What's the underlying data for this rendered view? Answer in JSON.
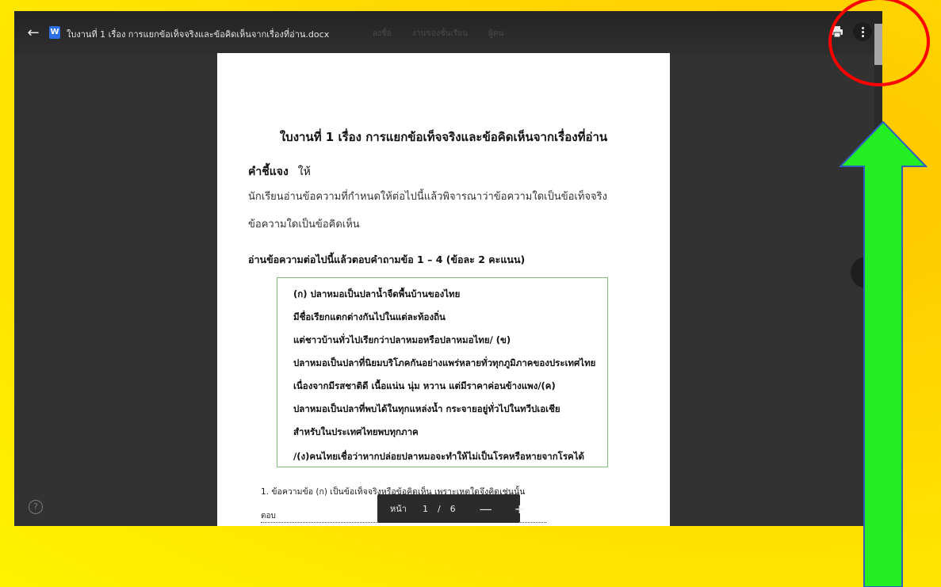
{
  "viewer": {
    "file_name": "ใบงานที่ 1 เรื่อง การแยกข้อเท็จจริงและข้อคิดเห็นจากเรื่องที่อ่าน.docx",
    "app_letter": "W",
    "menu_items": [
      "ลงชื่อ",
      "งานของชั้นเรียน",
      "ผู้คน"
    ]
  },
  "document": {
    "title": "ใบงานที่   1  เรื่อง การแยกข้อเท็จจริงและข้อคิดเห็นจากเรื่องที่อ่าน",
    "instruction_label": "คำชี้แจง",
    "instruction_word": "ให้",
    "instruction_lines": [
      "นักเรียนอ่านข้อความที่กำหนดให้ต่อไปนี้แล้วพิจารณาว่าข้อความใดเป็นข้อเท็จจริง",
      "ข้อความใดเป็นข้อคิดเห็น"
    ],
    "question_heading": "อ่านข้อความต่อไปนี้แล้วตอบคำถามข้อ 1 – 4  (ข้อละ  2  คะแนน)",
    "passage_lines": [
      "(ก) ปลาหมอเป็นปลาน้ำจืดพื้นบ้านของไทย",
      "มีชื่อเรียกแตกต่างกันไปในแต่ละท้องถิ่น",
      "แต่ชาวบ้านทั่วไปเรียกว่าปลาหมอหรือปลาหมอไทย/  (ข)",
      "ปลาหมอเป็นปลาที่นิยมบริโภคกันอย่างแพร่หลายทั่วทุกภูมิภาคของประเทศไทย",
      "เนื่องจากมีรสชาติดี  เนื้อแน่น  นุ่ม  หวาน  แต่มีราคาค่อนข้างแพง/(ค)",
      "ปลาหมอเป็นปลาที่พบได้ในทุกแหล่งน้ำ   กระจายอยู่ทั่วไปในทวีปเอเชีย",
      "สำหรับในประเทศไทยพบทุกภาค",
      "/(ง)คนไทยเชื่อว่าหากปล่อยปลาหมอจะทำให้ไม่เป็นโรคหรือหายจากโรคได้"
    ],
    "question_1": "1. ข้อความข้อ  (ก)   เป็นข้อเท็จจริงหรือข้อคิดเห็น   เพราะเหตุใดจึงคิดเช่นนั้น",
    "answer_label": "ตอบ"
  },
  "pager": {
    "label": "หน้า",
    "current": "1",
    "separator": "/",
    "total": "6",
    "zoom_out": "—",
    "zoom_in": "+"
  },
  "help_symbol": "?",
  "icons": [
    "back-arrow-icon",
    "word-file-icon",
    "print-icon",
    "more-vert-icon",
    "zoom-icon",
    "help-icon"
  ],
  "colors": {
    "background": "#ffd500",
    "annotation_circle": "#ff0000",
    "annotation_arrow": "#22ee22",
    "arrow_outline": "#2e5fbf",
    "viewer_bg": "#323232"
  }
}
